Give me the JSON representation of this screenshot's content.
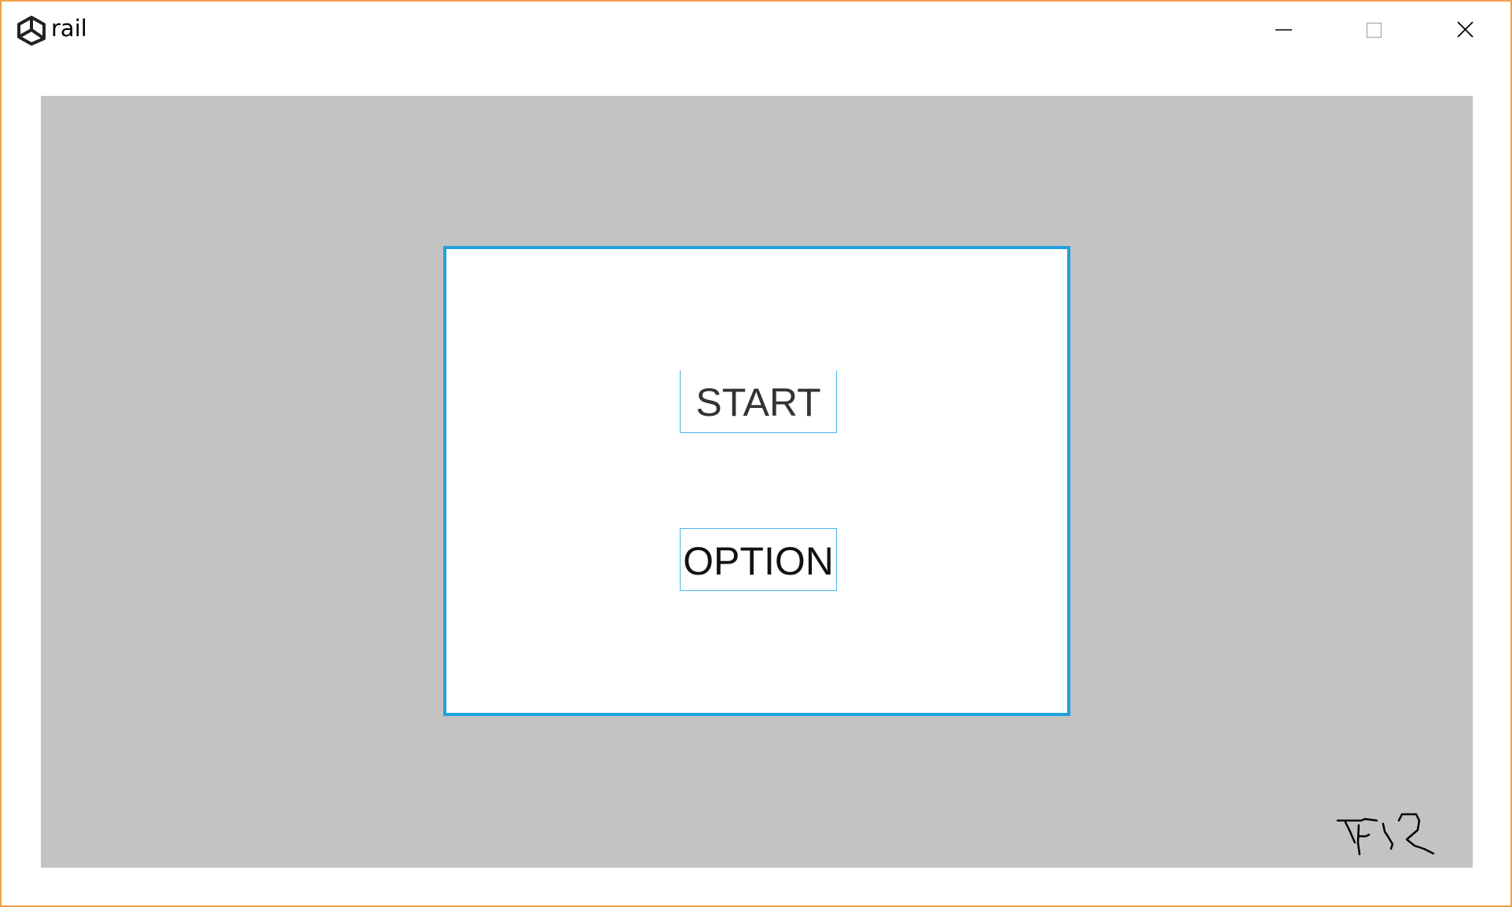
{
  "window": {
    "title": "rail",
    "app_icon": "unity-logo-icon",
    "controls": {
      "minimize_icon": "minimize-icon",
      "maximize_icon": "maximize-icon",
      "close_icon": "close-icon"
    }
  },
  "menu": {
    "start_label": "START",
    "option_label": "OPTION"
  },
  "colors": {
    "window_border": "#f0a04b",
    "viewport_bg": "#c3c3c3",
    "panel_border": "#1fa1dc",
    "button_border": "#48b8e8"
  }
}
